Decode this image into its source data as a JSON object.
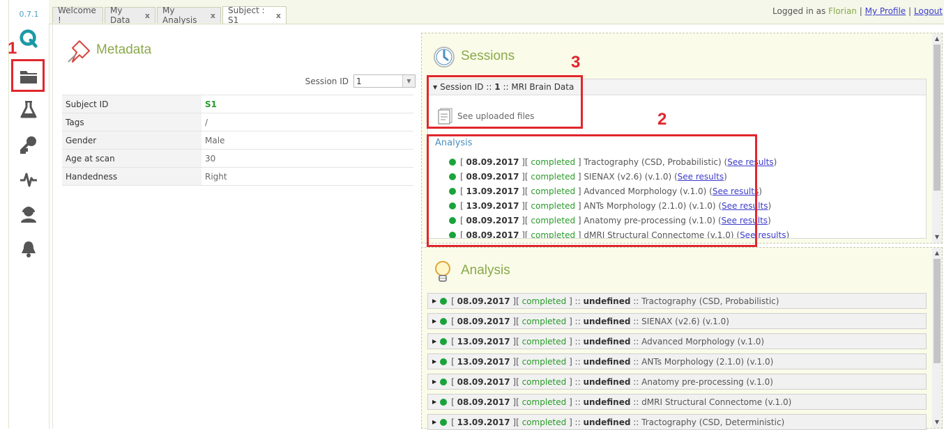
{
  "app": {
    "version": "0.7.1"
  },
  "rail": {
    "icons": [
      "logo-icon",
      "folder-icon",
      "flask-icon",
      "key-icon",
      "pulse-icon",
      "user-support-icon",
      "bell-icon"
    ]
  },
  "tabs": [
    {
      "label": "Welcome !"
    },
    {
      "label": "My Data",
      "close": "x"
    },
    {
      "label": "My Analysis",
      "close": "x"
    },
    {
      "label": "Subject : S1",
      "close": "x"
    }
  ],
  "login": {
    "prefix": "Logged in as",
    "user": "Florian",
    "sep": "|",
    "profile": "My Profile",
    "logout": "Logout"
  },
  "metadata": {
    "title": "Metadata",
    "session_label": "Session ID",
    "session_value": "1",
    "rows": [
      {
        "key": "Subject ID",
        "value": "S1"
      },
      {
        "key": "Tags",
        "value": "/"
      },
      {
        "key": "Gender",
        "value": "Male"
      },
      {
        "key": "Age at scan",
        "value": "30"
      },
      {
        "key": "Handedness",
        "value": "Right"
      }
    ]
  },
  "sessions": {
    "title": "Sessions",
    "header": {
      "prefix": "Session ID ::",
      "id": "1",
      "sep": "::",
      "name": "MRI Brain Data"
    },
    "uploaded": "See uploaded files",
    "analysis_title": "Analysis",
    "results_label": "See results",
    "items": [
      {
        "date": "08.09.2017",
        "status": "completed",
        "name": "Tractography (CSD, Probabilistic)"
      },
      {
        "date": "08.09.2017",
        "status": "completed",
        "name": "SIENAX (v2.6) (v.1.0)"
      },
      {
        "date": "13.09.2017",
        "status": "completed",
        "name": "Advanced Morphology (v.1.0)"
      },
      {
        "date": "13.09.2017",
        "status": "completed",
        "name": "ANTs Morphology (2.1.0) (v.1.0)"
      },
      {
        "date": "08.09.2017",
        "status": "completed",
        "name": "Anatomy pre-processing (v.1.0)"
      },
      {
        "date": "08.09.2017",
        "status": "completed",
        "name": "dMRI Structural Connectome (v.1.0)"
      }
    ]
  },
  "analysis": {
    "title": "Analysis",
    "undefined_label": "undefined",
    "items": [
      {
        "date": "08.09.2017",
        "status": "completed",
        "name": "Tractography (CSD, Probabilistic)"
      },
      {
        "date": "08.09.2017",
        "status": "completed",
        "name": "SIENAX (v2.6) (v.1.0)"
      },
      {
        "date": "13.09.2017",
        "status": "completed",
        "name": "Advanced Morphology (v.1.0)"
      },
      {
        "date": "13.09.2017",
        "status": "completed",
        "name": "ANTs Morphology (2.1.0) (v.1.0)"
      },
      {
        "date": "08.09.2017",
        "status": "completed",
        "name": "Anatomy pre-processing (v.1.0)"
      },
      {
        "date": "08.09.2017",
        "status": "completed",
        "name": "dMRI Structural Connectome (v.1.0)"
      },
      {
        "date": "13.09.2017",
        "status": "completed",
        "name": "Tractography (CSD, Deterministic)"
      }
    ]
  },
  "annotations": {
    "one": "1",
    "two": "2",
    "three": "3"
  },
  "colors": {
    "accent": "#8aa84a",
    "status_ok": "#1aa33a",
    "annotation": "#e0262c",
    "link": "#3c3ccc"
  }
}
